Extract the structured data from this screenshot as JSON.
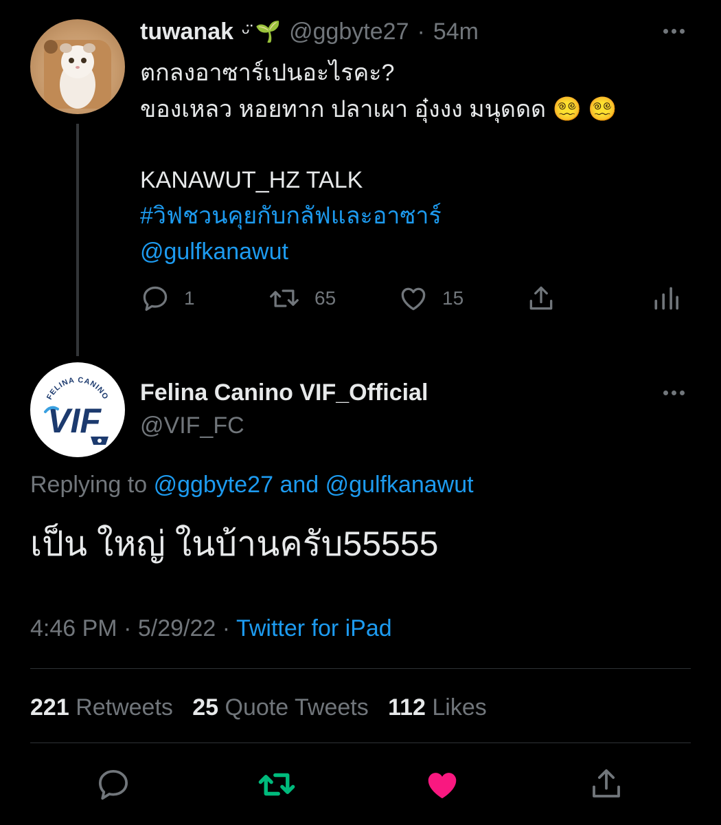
{
  "parent_tweet": {
    "display_name": "tuwanak",
    "name_emoji": "ᵕ̈ 🌱",
    "handle": "@ggbyte27",
    "separator": "·",
    "time": "54m",
    "line1": "ตกลงอาซาร์เปนอะไรคะ?",
    "line2": "ของเหลว หอยทาก ปลาเผา อุ๋งงง มนุดดด 😵‍💫 😵‍💫",
    "line3": "KANAWUT_HZ TALK",
    "hashtag": "#วิฟชวนคุยกับกลัฟและอาซาร์",
    "mention": "@gulfkanawut",
    "actions": {
      "replies": "1",
      "retweets": "65",
      "likes": "15"
    }
  },
  "reply_tweet": {
    "display_name": "Felina Canino VIF_Official",
    "handle": "@VIF_FC",
    "logo_text": "VIF",
    "logo_arc": "FELINA CANINO",
    "replying_prefix": "Replying to",
    "replying_user1": "@ggbyte27",
    "replying_and": "and",
    "replying_user2": "@gulfkanawut",
    "text": "เป็น ใหญ่ ในบ้านครับ55555",
    "time": "4:46 PM",
    "dot": "·",
    "date": "5/29/22",
    "source": "Twitter for iPad",
    "stats": {
      "retweets_count": "221",
      "retweets_label": "Retweets",
      "quotes_count": "25",
      "quotes_label": "Quote Tweets",
      "likes_count": "112",
      "likes_label": "Likes"
    }
  },
  "colors": {
    "background": "#000000",
    "link": "#1d9bf0",
    "muted": "#71767b",
    "retweet_active": "#00ba7c",
    "like_active": "#f91880"
  }
}
